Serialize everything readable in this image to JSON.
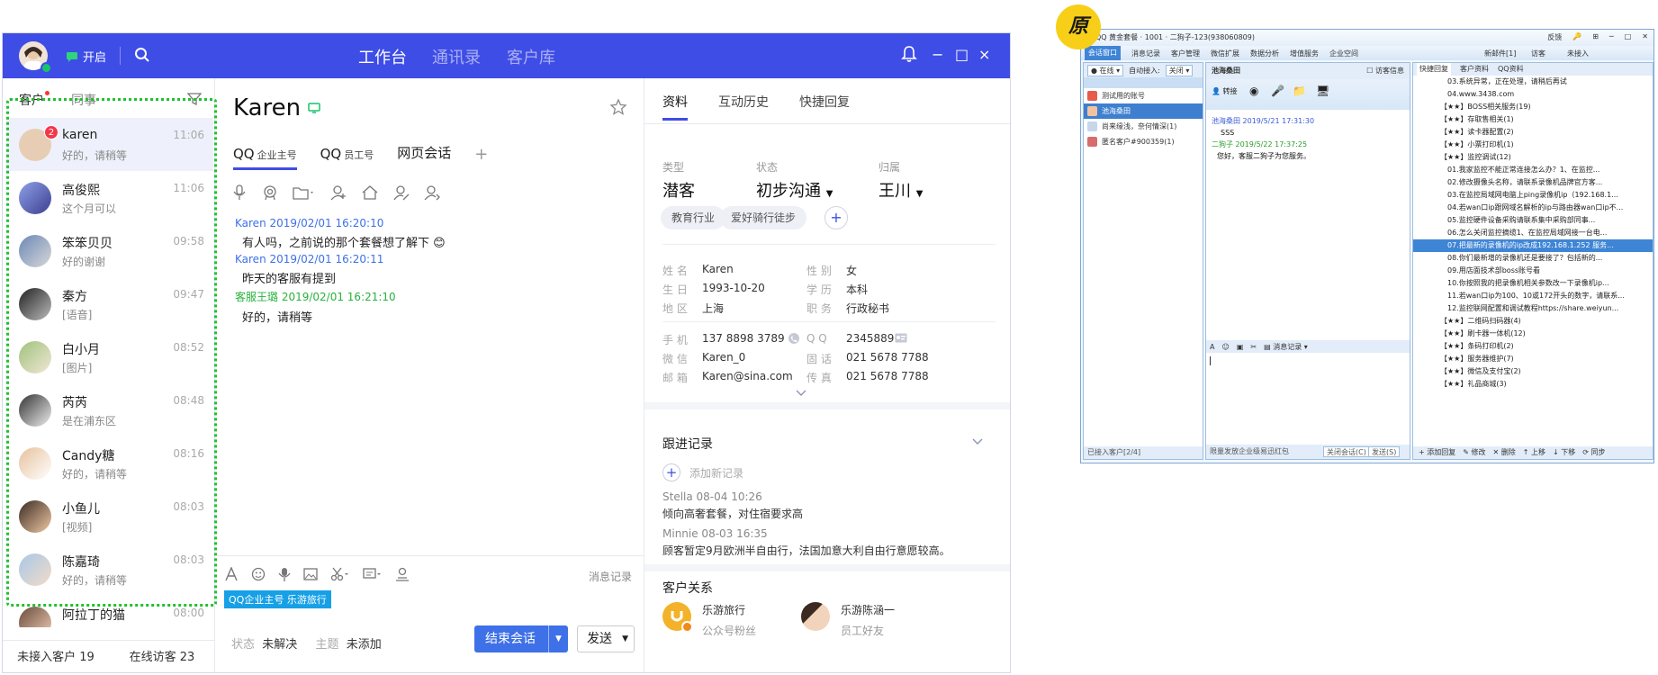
{
  "app": {
    "status_label": "开启",
    "nav_tabs": [
      "工作台",
      "通讯录",
      "客户库"
    ],
    "window_controls": [
      "−",
      "□",
      "×"
    ]
  },
  "left": {
    "tabs": [
      "客户",
      "同事"
    ],
    "conversations": [
      {
        "name": "karen",
        "preview": "好的，请稍等",
        "time": "11:06",
        "badge": "2"
      },
      {
        "name": "高俊熙",
        "preview": "这个月可以",
        "time": "11:06"
      },
      {
        "name": "笨笨贝贝",
        "preview": "好的谢谢",
        "time": "09:58"
      },
      {
        "name": "秦方",
        "preview": "[语音]",
        "time": "09:47"
      },
      {
        "name": "白小月",
        "preview": "[图片]",
        "time": "08:52"
      },
      {
        "name": "芮芮",
        "preview": "是在浦东区",
        "time": "08:48"
      },
      {
        "name": "Candy糖",
        "preview": "好的，请稍等",
        "time": "08:16"
      },
      {
        "name": "小鱼儿",
        "preview": "[视频]",
        "time": "08:03"
      },
      {
        "name": "陈嘉琦",
        "preview": "好的，请稍等",
        "time": "08:03"
      },
      {
        "name": "阿拉丁的猫",
        "preview": "",
        "time": "08:00"
      }
    ],
    "footer": {
      "unconnected": "未接入客户 19",
      "online": "在线访客 23"
    }
  },
  "chat": {
    "title": "Karen",
    "tabs": [
      {
        "label": "QQ",
        "sub": "企业主号"
      },
      {
        "label": "QQ",
        "sub": "员工号"
      },
      {
        "label": "网页会话",
        "sub": ""
      }
    ],
    "messages": [
      {
        "header": "Karen 2019/02/01 16:20:10",
        "body": "有人吗，之前说的那个套餐想了解下 😊"
      },
      {
        "header": "Karen 2019/02/01 16:20:11",
        "body": "昨天的客服有提到"
      },
      {
        "header": "客服王璐 2019/02/01 16:21:10",
        "body": "好的，请稍等"
      }
    ],
    "msg_record": "消息记录",
    "qq_tag": "QQ企业主号 乐游旅行",
    "status_key": "状态",
    "status_val": "未解决",
    "topic_key": "主题",
    "topic_val": "未添加",
    "end_button": "结束会话",
    "send_button": "发送"
  },
  "profile": {
    "tabs": [
      "资料",
      "互动历史",
      "快捷回复"
    ],
    "type_label": "类型",
    "type_value": "潜客",
    "state_label": "状态",
    "state_value": "初步沟通",
    "owner_label": "归属",
    "owner_value": "王川",
    "tags": [
      "教育行业",
      "爱好骑行徒步"
    ],
    "fields": {
      "name": [
        "姓 名",
        "Karen"
      ],
      "gender": [
        "性 别",
        "女"
      ],
      "birthday": [
        "生 日",
        "1993-10-20"
      ],
      "education": [
        "学 历",
        "本科"
      ],
      "region": [
        "地 区",
        "上海"
      ],
      "job": [
        "职 务",
        "行政秘书"
      ],
      "phone": [
        "手 机",
        "137 8898 3789"
      ],
      "qq": [
        "Q Q",
        "23458896"
      ],
      "wechat": [
        "微 信",
        "Karen_0"
      ],
      "tel": [
        "固 话",
        "021 5678 7788"
      ],
      "email": [
        "邮 箱",
        "Karen@sina.com"
      ],
      "fax": [
        "传 真",
        "021 5678 7788"
      ]
    },
    "followup_title": "跟进记录",
    "add_record": "添加新记录",
    "records": [
      {
        "meta": "Stella  08-04  10:26",
        "text": "倾向高奢套餐，对住宿要求高"
      },
      {
        "meta": "Minnie  08-03  16:35",
        "text": "顾客暂定9月欧洲半自由行，法国加意大利自由行意愿较高。"
      }
    ],
    "relation_title": "客户关系",
    "relations": [
      {
        "name": "乐游旅行",
        "desc": "公众号粉丝"
      },
      {
        "name": "乐游陈涵一",
        "desc": "员工好友"
      }
    ]
  },
  "label_badge": "原",
  "old": {
    "title": "QQ 黄金套餐 · 1001 · 二狗子-123(938060809)",
    "title_right": [
      "反馈",
      "🔑",
      "⊞",
      "─",
      "□",
      "✕"
    ],
    "menu": [
      "会话窗口",
      "消息记录",
      "客户管理",
      "微信扩展",
      "数据分析",
      "增值服务",
      "企业空间"
    ],
    "menu_right": [
      "新邮件[1]",
      "访客",
      "未接入"
    ],
    "left_bar": [
      "在线",
      "自动接入:",
      "关闭"
    ],
    "left_items": [
      "测试用的账号",
      "池海桑田",
      "尚来缘浅，奈何情深(1)",
      "匿名客户#900359(1)"
    ],
    "left_foot": "已接入客户[2/4]",
    "chat_title": "池海桑田",
    "visitor_info": "访客信息",
    "transfer": "转接",
    "chat_lines": [
      {
        "h": "池海桑田 2019/5/21 17:31:30",
        "b": "SSS"
      },
      {
        "h": "二狗子 2019/5/22 17:37:25",
        "b": "您好，客服二狗子为您服务。"
      }
    ],
    "chat_tool": "消息记录",
    "chat_foot": "限量发放企业级易迅红包",
    "chat_close": "关闭会话(C)",
    "chat_send": "发送(S)",
    "right_tabs": [
      "快捷回复",
      "客户资料",
      "QQ资料"
    ],
    "right_items": [
      "03.系统异常，正在处理，请稍后再试",
      "04.www.3438.com",
      "【★★】BOSS相关服务(19)",
      "【★★】存取售相关(1)",
      "【★★】读卡器配置(2)",
      "【★★】小票打印机(1)",
      "【★★】监控调试(12)",
      "01.我家监控不能正常连接怎么办？1、在监控...",
      "02.修改摄像头名称，请联系录像机品牌官方客...",
      "03.在监控局域网电脑上ping录像机ip（192.168.1...",
      "04.若wan口ip跟网域名解析的ip与路由器wan口ip不...",
      "05.监控硬件设备采购请联系集中采购部同事...",
      "06.怎么关闭监控摘缆1、在监控局域网接一台电...",
      "07.把最新的录像机的ip改成192.168.1.252 服务...",
      "08.你们最新增的录像机还是要接了？包括新的...",
      "09.用店面技术部boss账号看",
      "10.你按照我的把录像机相关参数改一下录像机ip...",
      "11.若wan口ip为100、10或172开头的数字，请联系...",
      "12.监控联网配置和调试教程https://share.weiyun...",
      "【★★】二维码扫码器(4)",
      "【★★】刷卡器一体机(12)",
      "【★★】条码打印机(2)",
      "【★★】服务器维护(7)",
      "【★★】微信及支付宝(2)",
      "【★★】礼品商城(3)"
    ],
    "right_foot": [
      "+ 添加回复",
      "✎ 修改",
      "✕ 删除",
      "↑ 上移",
      "↓ 下移",
      "⟳ 同步"
    ]
  }
}
